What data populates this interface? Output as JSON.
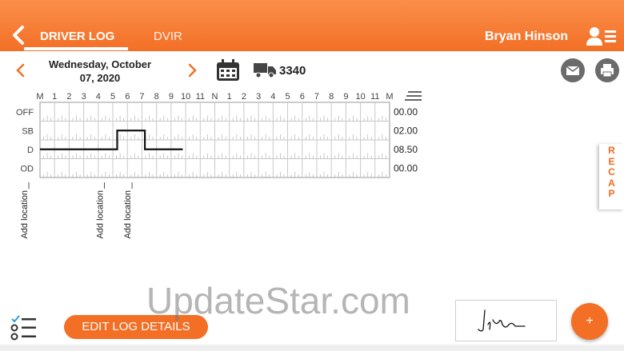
{
  "header": {
    "tabs": [
      {
        "label": "DRIVER LOG",
        "active": true
      },
      {
        "label": "DVIR",
        "active": false
      }
    ],
    "user_name": "Bryan Hinson",
    "icons": {
      "back": "chevron-left-icon",
      "user": "user-list-icon"
    },
    "accent_color": "#f36f26"
  },
  "date_nav": {
    "date_line1": "Wednesday, October",
    "date_line2": "07, 2020",
    "truck_number": "3340",
    "icons": [
      "chevron-left-icon",
      "chevron-right-icon",
      "calendar-icon",
      "truck-icon",
      "mail-icon",
      "printer-icon"
    ]
  },
  "log_graph": {
    "hour_labels": [
      "M",
      "1",
      "2",
      "3",
      "4",
      "5",
      "6",
      "7",
      "8",
      "9",
      "10",
      "11",
      "N",
      "1",
      "2",
      "3",
      "4",
      "5",
      "6",
      "7",
      "8",
      "9",
      "10",
      "11",
      "M"
    ],
    "statuses": [
      {
        "label": "OFF",
        "total": "00.00"
      },
      {
        "label": "SB",
        "total": "02.00"
      },
      {
        "label": "D",
        "total": "08.50"
      },
      {
        "label": "OD",
        "total": "00.00"
      }
    ],
    "segments": [
      {
        "status": "D",
        "start": 0,
        "end": 5.3
      },
      {
        "status": "SB",
        "start": 5.3,
        "end": 7.2
      },
      {
        "status": "D",
        "start": 7.2,
        "end": 9.8
      }
    ],
    "location_markers": [
      {
        "hour": 0,
        "label": "Add location"
      },
      {
        "hour": 5.3,
        "label": "Add location"
      },
      {
        "hour": 7.2,
        "label": "Add location"
      }
    ]
  },
  "recap": {
    "letters": [
      "R",
      "E",
      "C",
      "A",
      "P"
    ]
  },
  "footer": {
    "edit_button": "EDIT LOG DETAILS",
    "fab_label": "+",
    "watermark": "UpdateStar.com",
    "icons": {
      "checklist": "checklist-icon",
      "signature": "signature"
    }
  }
}
